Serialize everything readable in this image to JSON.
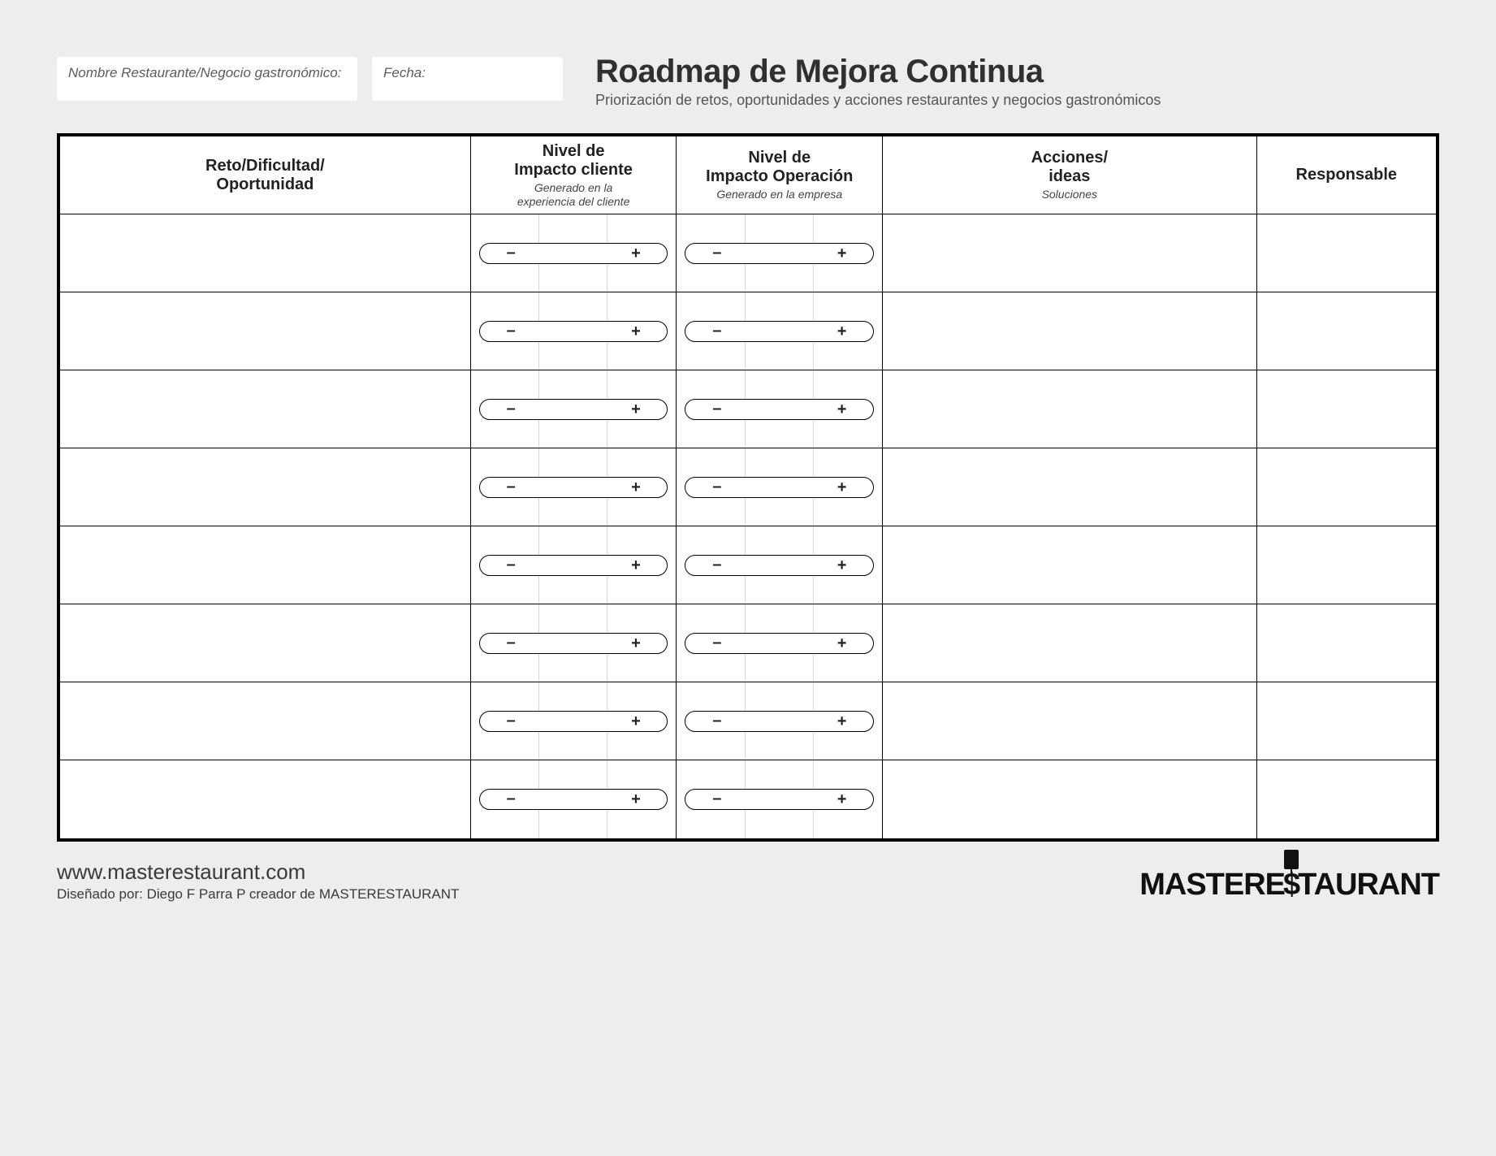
{
  "header": {
    "name_label": "Nombre Restaurante/Negocio gastronómico:",
    "date_label": "Fecha:",
    "title": "Roadmap de Mejora Continua",
    "subtitle": "Priorización de retos, oportunidades y acciones restaurantes y negocios gastronómicos"
  },
  "columns": {
    "c1": {
      "h1": "Reto/Dificultad/\nOportunidad"
    },
    "c2": {
      "h1": "Nivel de\nImpacto cliente",
      "h2": "Generado en la\nexperiencia del cliente"
    },
    "c3": {
      "h1": "Nivel de\nImpacto Operación",
      "h2": "Generado en la empresa"
    },
    "c4": {
      "h1": "Acciones/\nideas",
      "h2": "Soluciones"
    },
    "c5": {
      "h1": "Responsable"
    }
  },
  "pill": {
    "minus": "–",
    "plus": "+"
  },
  "row_count": 8,
  "footer": {
    "url": "www.masterestaurant.com",
    "credit": "Diseñado por: Diego F Parra P creador de MASTERESTAURANT",
    "logo_left": "MASTERE",
    "logo_mid": "$",
    "logo_right": "TAURANT"
  }
}
